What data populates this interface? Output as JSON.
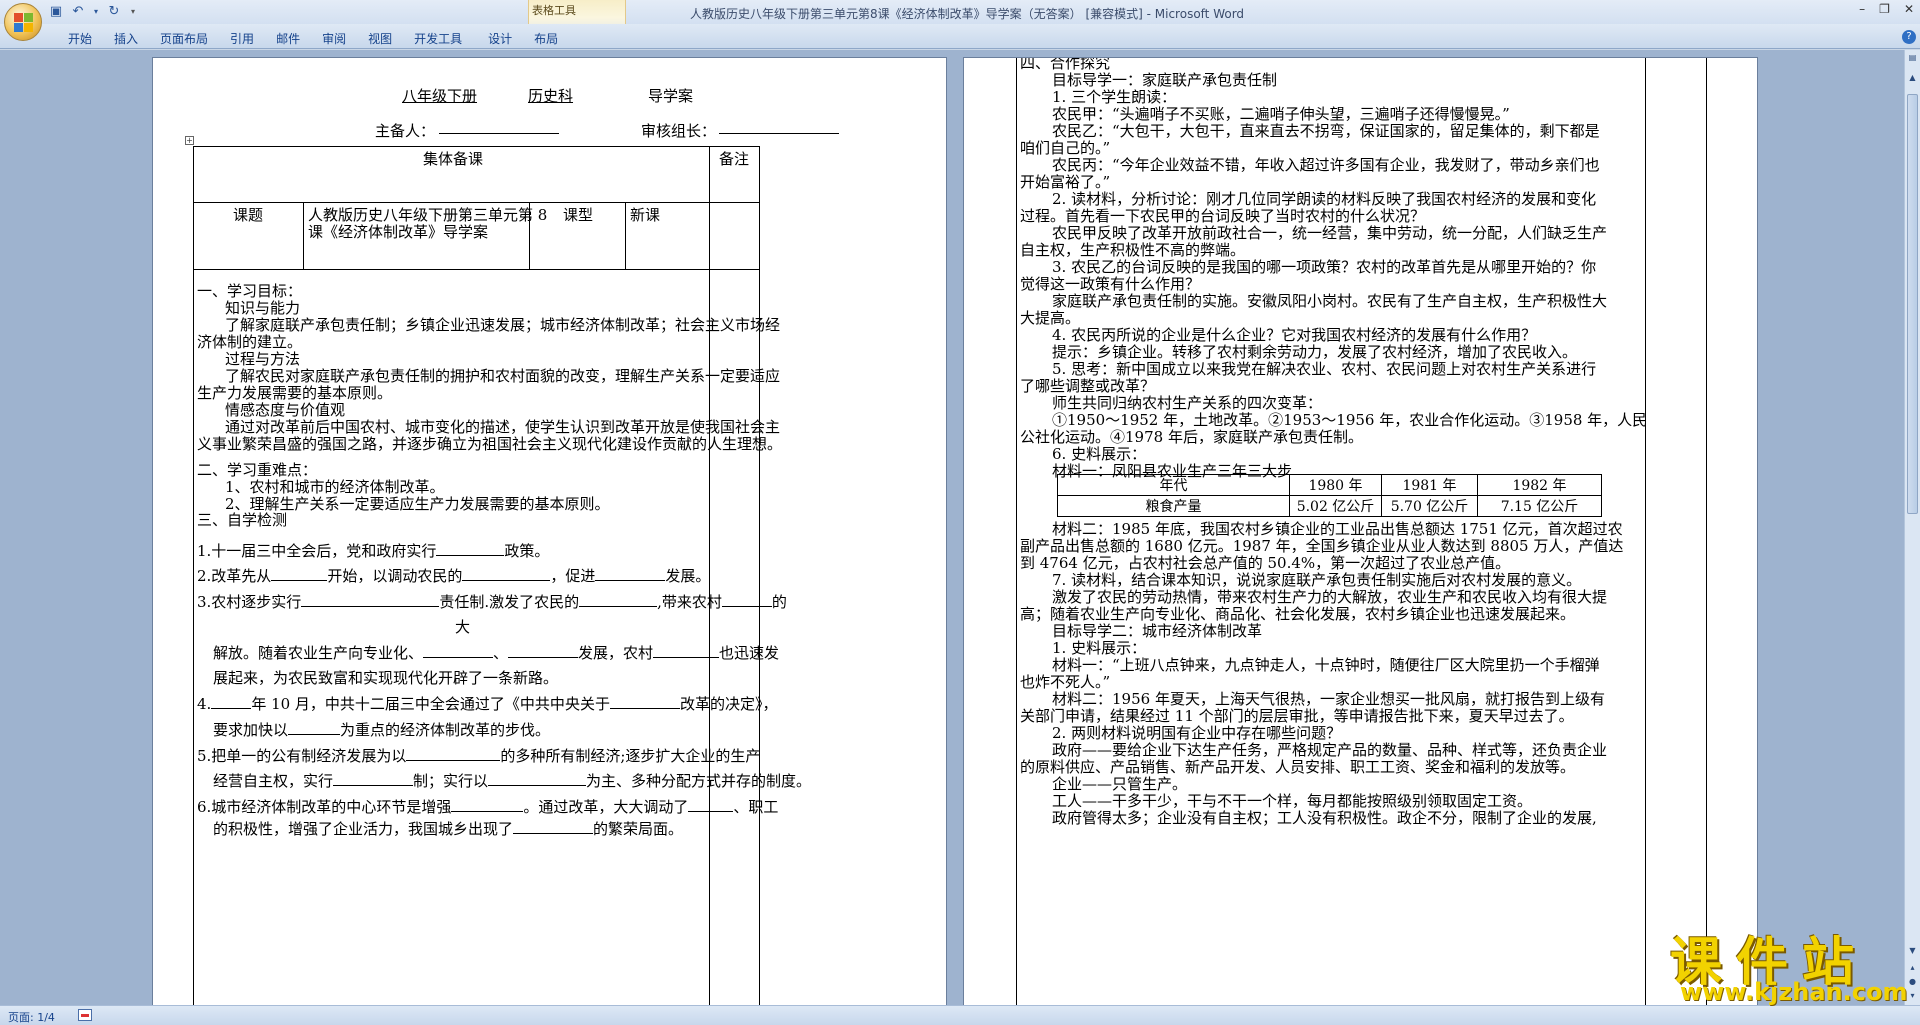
{
  "app": {
    "window_title": "人教版历史八年级下册第三单元第8课《经济体制改革》导学案（无答案） [兼容模式] - Microsoft Word",
    "contextual_tab_group": "表格工具",
    "window_controls": [
      "–",
      "❐",
      "✕"
    ],
    "help": "?"
  },
  "ribbon": {
    "tabs": [
      "开始",
      "插入",
      "页面布局",
      "引用",
      "邮件",
      "审阅",
      "视图",
      "开发工具",
      "设计",
      "布局"
    ]
  },
  "status": {
    "page": "页面: 1/4"
  },
  "watermark": {
    "brand": "课件站",
    "url": "www.kjzhan.com"
  },
  "page1": {
    "header_line": [
      "八年级下册",
      "历史科",
      "导学案"
    ],
    "prep_label": "主备人：",
    "review_label": "审核组长：",
    "table": {
      "group_prep": "集体备课",
      "remark": "备注",
      "topic_label": "课题",
      "topic_value_1": "人教版历史八年级下册第三单元第 8",
      "topic_value_2": "课《经济体制改革》导学案",
      "type_label": "课型",
      "type_value": "新课"
    },
    "lines": [
      "一、学习目标：",
      "知识与能力",
      "了解家庭联产承包责任制；乡镇企业迅速发展；城市经济体制改革；社会主义市场经",
      "济体制的建立。",
      "过程与方法",
      "了解农民对家庭联产承包责任制的拥护和农村面貌的改变，理解生产关系一定要适应",
      "生产力发展需要的基本原则。",
      "情感态度与价值观",
      "通过对改革前后中国农村、城市变化的描述，使学生认识到改革开放是使我国社会主",
      "义事业繁荣昌盛的强国之路，并逐步确立为祖国社会主义现代化建设作贡献的人生理想。",
      "二、学习重难点：",
      "1、农村和城市的经济体制改革。",
      "2、理解生产关系一定要适应生产力发展需要的基本原则。",
      "三、自学检测"
    ],
    "q1": [
      "1.十一届三中全会后，党和政府实行",
      "政策。"
    ],
    "q2": [
      "2.改革先从",
      "开始，以调动农民的",
      "，促进",
      "发展。"
    ],
    "q3": [
      "3.农村逐步实行",
      "责任制.激发了农民的",
      ",带来农村",
      "的"
    ],
    "q3b": "大",
    "q3c": [
      "解放。随着农业生产向专业化、",
      "、",
      "发展，农村",
      "也迅速发"
    ],
    "q3d": "展起来，为农民致富和实现现代化开辟了一条新路。",
    "q4": [
      "4.",
      "年 10 月，中共十二届三中全会通过了《中共中央关于",
      "改革的决定》，"
    ],
    "q4b": [
      "要求加快以",
      "为重点的经济体制改革的步伐。"
    ],
    "q5": [
      "5.把单一的公有制经济发展为以",
      "的多种所有制经济;逐步扩大企业的生产"
    ],
    "q5b": [
      "经营自主权，实行",
      "制；实行以",
      "为主、多种分配方式并存的制度。"
    ],
    "q6": [
      "6.城市经济体制改革的中心环节是增强",
      "。通过改革，大大调动了",
      "、职工"
    ],
    "q6b": [
      "的积极性，增强了企业活力，我国城乡出现了",
      "的繁荣局面。"
    ]
  },
  "page2": {
    "lines": [
      "四、合作探究",
      "目标导学一：家庭联产承包责任制",
      "1. 三个学生朗读：",
      "农民甲：“头遍哨子不买账，二遍哨子伸头望，三遍哨子还得慢慢晃。”",
      "农民乙：“大包干，大包干，直来直去不拐弯，保证国家的，留足集体的，剩下都是",
      "咱们自己的。”",
      "农民丙：“今年企业效益不错，年收入超过许多国有企业，我发财了，带动乡亲们也",
      "开始富裕了。”",
      "2. 读材料，分析讨论：刚才几位同学朗读的材料反映了我国农村经济的发展和变化",
      "过程。首先看一下农民甲的台词反映了当时农村的什么状况？",
      "农民甲反映了改革开放前政社合一，统一经营，集中劳动，统一分配，人们缺乏生产",
      "自主权，生产积极性不高的弊端。",
      "3. 农民乙的台词反映的是我国的哪一项政策？农村的改革首先是从哪里开始的？你",
      "觉得这一政策有什么作用？",
      "家庭联产承包责任制的实施。安徽凤阳小岗村。农民有了生产自主权，生产积极性大",
      "大提高。",
      "4. 农民丙所说的企业是什么企业？它对我国农村经济的发展有什么作用？",
      "提示：乡镇企业。转移了农村剩余劳动力，发展了农村经济，增加了农民收入。",
      "5. 思考：新中国成立以来我党在解决农业、农村、农民问题上对农村生产关系进行",
      "了哪些调整或改革？",
      "师生共同归纳农村生产关系的四次变革：",
      "①1950～1952 年，土地改革。②1953～1956 年，农业合作化运动。③1958 年，人民",
      "公社化运动。④1978 年后，家庭联产承包责任制。",
      "6. 史料展示：",
      "材料一：凤阳县农业生产三年三大步"
    ],
    "yield_table": {
      "header": [
        "年代",
        "1980 年",
        "1981 年",
        "1982 年"
      ],
      "row": [
        "粮食产量",
        "5.02 亿公斤",
        "5.70 亿公斤",
        "7.15 亿公斤"
      ]
    },
    "lines2": [
      "材料二：1985 年底，我国农村乡镇企业的工业品出售总额达 1751 亿元，首次超过农",
      "副产品出售总额的 1680 亿元。1987 年，全国乡镇企业从业人数达到 8805 万人，产值达",
      "到 4764 亿元，占农村社会总产值的 50.4%，第一次超过了农业总产值。",
      "7. 读材料，结合课本知识，说说家庭联产承包责任制实施后对农村发展的意义。",
      "激发了农民的劳动热情，带来农村生产力的大解放，农业生产和农民收入均有很大提",
      "高；随着农业生产向专业化、商品化、社会化发展，农村乡镇企业也迅速发展起来。",
      "目标导学二：城市经济体制改革",
      "1. 史料展示：",
      "材料一：“上班八点钟来，九点钟走人，十点钟时，随便往厂区大院里扔一个手榴弹",
      "也炸不死人。”",
      "材料二：1956 年夏天，上海天气很热，一家企业想买一批风扇，就打报告到上级有",
      "关部门申请，结果经过 11 个部门的层层审批，等申请报告批下来，夏天早过去了。",
      "2. 两则材料说明国有企业中存在哪些问题？",
      "政府——要给企业下达生产任务，严格规定产品的数量、品种、样式等，还负责企业",
      "的原料供应、产品销售、新产品开发、人员安排、职工工资、奖金和福利的发放等。",
      "企业——只管生产。",
      "工人——干多干少，干与不干一个样，每月都能按照级别领取固定工资。",
      "政府管得太多；企业没有自主权；工人没有积极性。政企不分，限制了企业的发展,"
    ]
  }
}
